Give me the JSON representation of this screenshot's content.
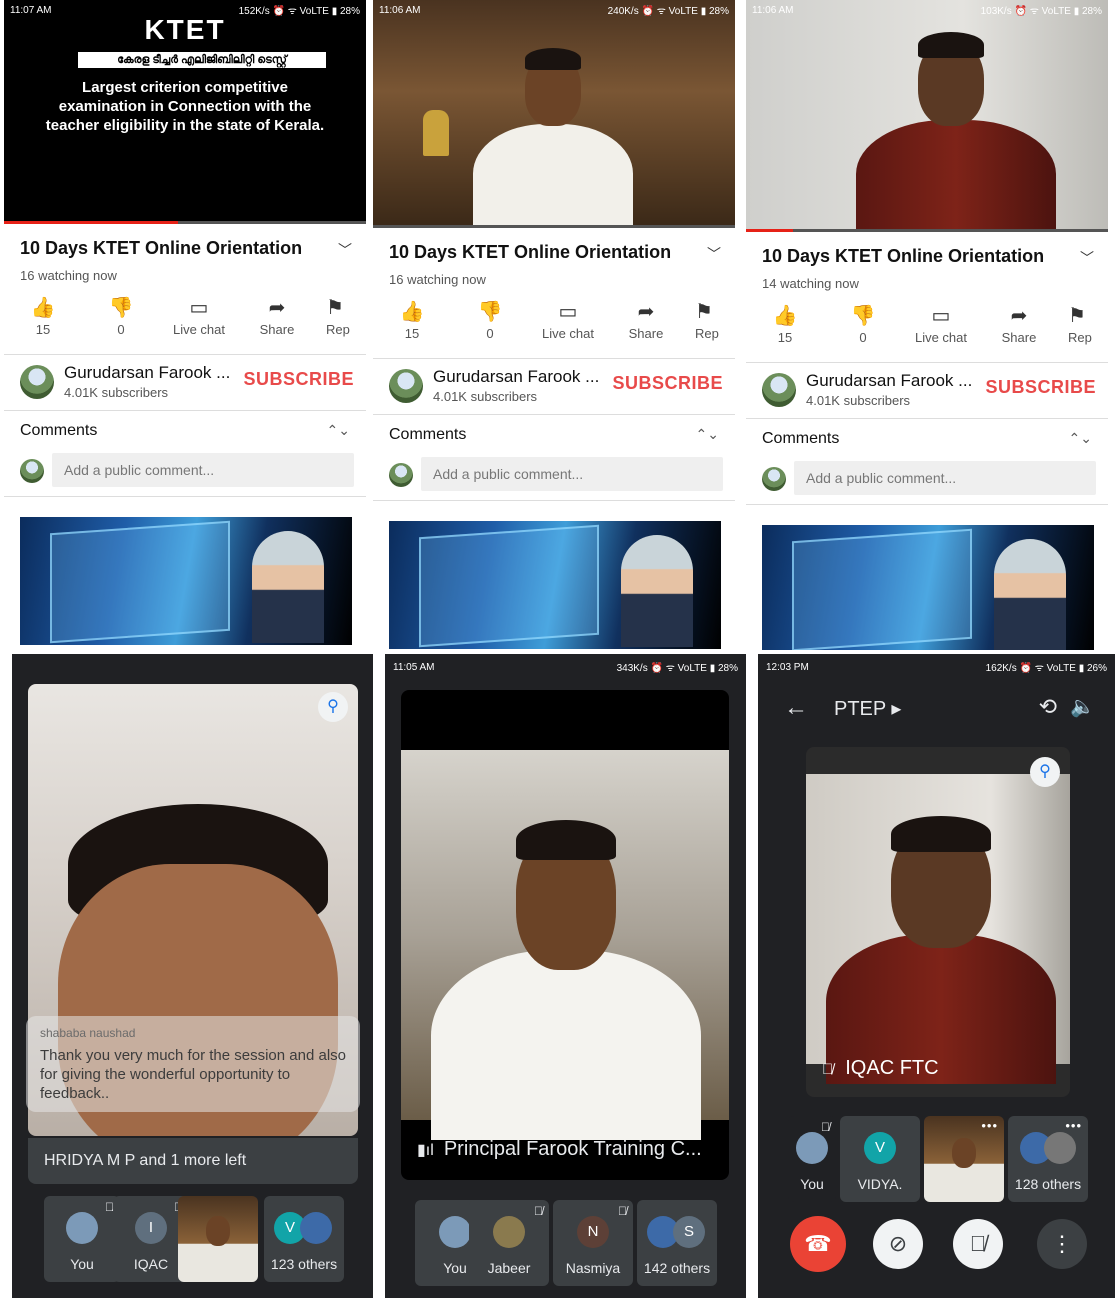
{
  "colors": {
    "youtube_red": "#e62117",
    "subscribe": "#e84a4a",
    "meet_bg": "#202124",
    "meet_tile": "#3c4043",
    "end_call": "#ea4335",
    "pin_blue": "#1a73e8"
  },
  "yt_panels": [
    {
      "status": {
        "time": "11:07 AM",
        "speed": "152K/s",
        "net": "VoLTE",
        "battery": "28%"
      },
      "video": {
        "heading": "KTET",
        "malayalam": "കേരള ടീച്ചർ എലിജിബിലിറ്റി ടെസ്റ്റ്",
        "text": "Largest criterion competitive examination in Connection with the teacher eligibility in the state of Kerala.",
        "progress": 0.48
      },
      "title": "10 Days KTET Online Orientation",
      "watching": "16 watching now",
      "actions": {
        "likes": "15",
        "dislikes": "0",
        "chat": "Live chat",
        "share": "Share",
        "report": "Rep"
      },
      "channel": {
        "name": "Gurudarsan Farook ...",
        "subs": "4.01K subscribers",
        "subscribe": "SUBSCRIBE"
      },
      "comments": {
        "header": "Comments",
        "placeholder": "Add a public comment..."
      }
    },
    {
      "status": {
        "time": "11:06 AM",
        "speed": "240K/s",
        "net": "VoLTE",
        "battery": "28%"
      },
      "video": {
        "progress": 0.0
      },
      "title": "10 Days KTET Online Orientation",
      "watching": "16 watching now",
      "actions": {
        "likes": "15",
        "dislikes": "0",
        "chat": "Live chat",
        "share": "Share",
        "report": "Rep"
      },
      "channel": {
        "name": "Gurudarsan Farook ...",
        "subs": "4.01K subscribers",
        "subscribe": "SUBSCRIBE"
      },
      "comments": {
        "header": "Comments",
        "placeholder": "Add a public comment..."
      }
    },
    {
      "status": {
        "time": "11:06 AM",
        "speed": "103K/s",
        "net": "VoLTE",
        "battery": "28%"
      },
      "video": {
        "progress": 0.13
      },
      "title": "10 Days KTET Online Orientation",
      "watching": "14 watching now",
      "actions": {
        "likes": "15",
        "dislikes": "0",
        "chat": "Live chat",
        "share": "Share",
        "report": "Rep"
      },
      "channel": {
        "name": "Gurudarsan Farook ...",
        "subs": "4.01K subscribers",
        "subscribe": "SUBSCRIBE"
      },
      "comments": {
        "header": "Comments",
        "placeholder": "Add a public comment..."
      }
    }
  ],
  "meet1": {
    "caption_name": "shababa naushad",
    "caption_text": "Thank you very much  for the session and also for giving the wonderful opportunity to feedback..",
    "notice": "HRIDYA M P and 1 more left",
    "participants": [
      {
        "label": "You",
        "muted": true
      },
      {
        "label": "IQAC",
        "initial": "I",
        "muted": true
      },
      {
        "label": "",
        "video": true
      },
      {
        "label": "123 others",
        "initial": "V"
      }
    ]
  },
  "meet2": {
    "status": {
      "time": "11:05 AM",
      "speed": "343K/s",
      "net": "VoLTE",
      "battery": "28%"
    },
    "speaker": "Principal Farook Training C...",
    "participants": [
      {
        "label": "You",
        "muted": true
      },
      {
        "label": "Jabeer",
        "muted": true
      },
      {
        "label": "Nasmiya",
        "initial": "N",
        "muted": true
      },
      {
        "label": "142 others",
        "initial": "S"
      }
    ]
  },
  "meet3": {
    "status": {
      "time": "12:03 PM",
      "speed": "162K/s",
      "net": "VoLTE",
      "battery": "26%"
    },
    "title": "PTEP",
    "speaker": "IQAC FTC",
    "participants": [
      {
        "label": "You",
        "muted": true
      },
      {
        "label": "VIDYA.",
        "initial": "V"
      },
      {
        "label": "",
        "video": true
      },
      {
        "label": "128 others"
      }
    ]
  },
  "icons": {
    "like": "thumbs-up-icon",
    "dislike": "thumbs-down-icon",
    "chat": "chat-icon",
    "share": "share-icon",
    "pin": "pin-icon",
    "mic_off": "mic-off-icon",
    "end_call": "end-call-icon",
    "cam_off": "camera-off-icon",
    "more": "more-vert-icon",
    "back": "back-arrow-icon",
    "switch_cam": "switch-camera-icon",
    "speaker": "speaker-icon"
  }
}
